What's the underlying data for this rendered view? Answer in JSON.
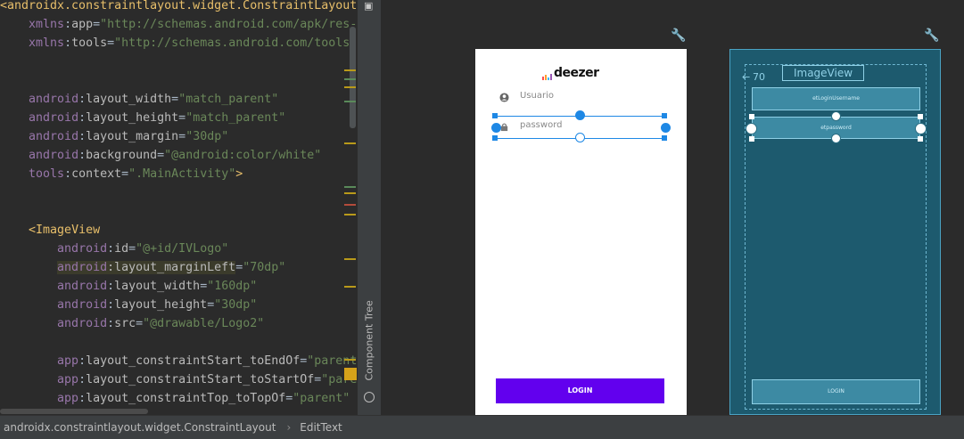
{
  "editor": {
    "lines": [
      {
        "text": "<androidx.constraintlayout.widget.ConstraintLayout",
        "kind": "tag-open"
      },
      {
        "text": "    xmlns:app=\"http://schemas.android.com/apk/res-",
        "kind": "xmlns"
      },
      {
        "text": "    xmlns:tools=\"http://schemas.android.com/tools\"",
        "kind": "xmlns"
      },
      {
        "text": "",
        "kind": "blank"
      },
      {
        "text": "",
        "kind": "blank"
      },
      {
        "text": "    android:layout_width=\"match_parent\"",
        "kind": "attr"
      },
      {
        "text": "    android:layout_height=\"match_parent\"",
        "kind": "attr"
      },
      {
        "text": "    android:layout_margin=\"30dp\"",
        "kind": "attr"
      },
      {
        "text": "    android:background=\"@android:color/white\"",
        "kind": "attr"
      },
      {
        "text": "    tools:context=\".MainActivity\">",
        "kind": "attr-close"
      },
      {
        "text": "",
        "kind": "blank"
      },
      {
        "text": "",
        "kind": "blank"
      },
      {
        "text": "    <ImageView",
        "kind": "child-tag"
      },
      {
        "text": "        android:id=\"@+id/IVLogo\"",
        "kind": "attr"
      },
      {
        "text": "        android:layout_marginLeft=\"70dp\"",
        "kind": "attr-hl"
      },
      {
        "text": "        android:layout_width=\"160dp\"",
        "kind": "attr"
      },
      {
        "text": "        android:layout_height=\"30dp\"",
        "kind": "attr"
      },
      {
        "text": "        android:src=\"@drawable/Logo2\"",
        "kind": "attr"
      },
      {
        "text": "",
        "kind": "blank"
      },
      {
        "text": "        app:layout_constraintStart_toEndOf=\"parent\"",
        "kind": "attr"
      },
      {
        "text": "        app:layout_constraintStart_toStartOf=\"pare",
        "kind": "attr"
      },
      {
        "text": "        app:layout_constraintTop_toTopOf=\"parent\"",
        "kind": "attr"
      }
    ]
  },
  "toolwindow": {
    "label": "Component Tree",
    "top_icon": "palette-icon",
    "bottom_icon": "component-tree-icon"
  },
  "design": {
    "logo_text": "deezer",
    "username_placeholder": "Usuario",
    "password_placeholder": "password",
    "login_label": "LOGIN",
    "colors": {
      "accent": "#6200ee",
      "selection": "#1e88e5"
    }
  },
  "blueprint": {
    "imageview_label": "ImageView",
    "margin_label": "70",
    "username_id": "etLoginUsername",
    "password_id": "etpassword",
    "login_label": "LOGIN"
  },
  "statusbar": {
    "crumb_1": "androidx.constraintlayout.widget.ConstraintLayout",
    "separator": "›",
    "crumb_2": "EditText"
  }
}
